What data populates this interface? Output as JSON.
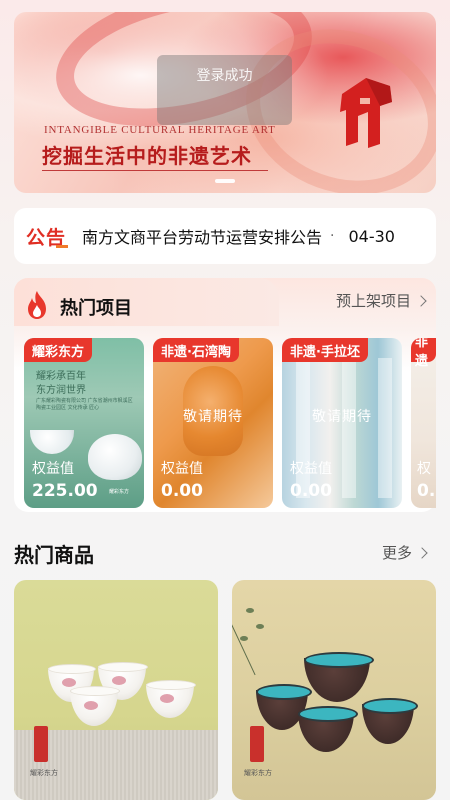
{
  "banner": {
    "toast": "登录成功",
    "en_title": "INTANGIBLE CULTURAL HERITAGE ART",
    "cn_title": "挖掘生活中的非遗艺术"
  },
  "notice": {
    "tag": "公告",
    "text": "南方文商平台劳动节运营安排公告",
    "separator": "·",
    "date": "04-30"
  },
  "hot_projects": {
    "title": "热门项目",
    "link": "预上架项目",
    "items": [
      {
        "label": "耀彩东方",
        "line1": "耀彩承百年",
        "line2": "东方润世界",
        "small": "广东耀彩陶瓷有限公司 广东省潮州市枫溪区陶瓷工业园区 文化传承 匠心",
        "eq_label": "权益值",
        "eq_value": "225.00",
        "brand": "耀彩东方"
      },
      {
        "label": "非遗·石湾陶",
        "wait": "敬请期待",
        "eq_label": "权益值",
        "eq_value": "0.00"
      },
      {
        "label": "非遗·手拉坯",
        "wait": "敬请期待",
        "eq_label": "权益值",
        "eq_value": "0.00"
      },
      {
        "label": "非遗",
        "eq_label": "权",
        "eq_value": "0."
      }
    ]
  },
  "hot_goods": {
    "title": "热门商品",
    "link": "更多",
    "items": [
      {
        "brand": "耀彩东方"
      },
      {
        "brand": "耀彩东方"
      }
    ]
  },
  "colors": {
    "accent": "#e8372c",
    "notice_tag": "#e02e24"
  }
}
